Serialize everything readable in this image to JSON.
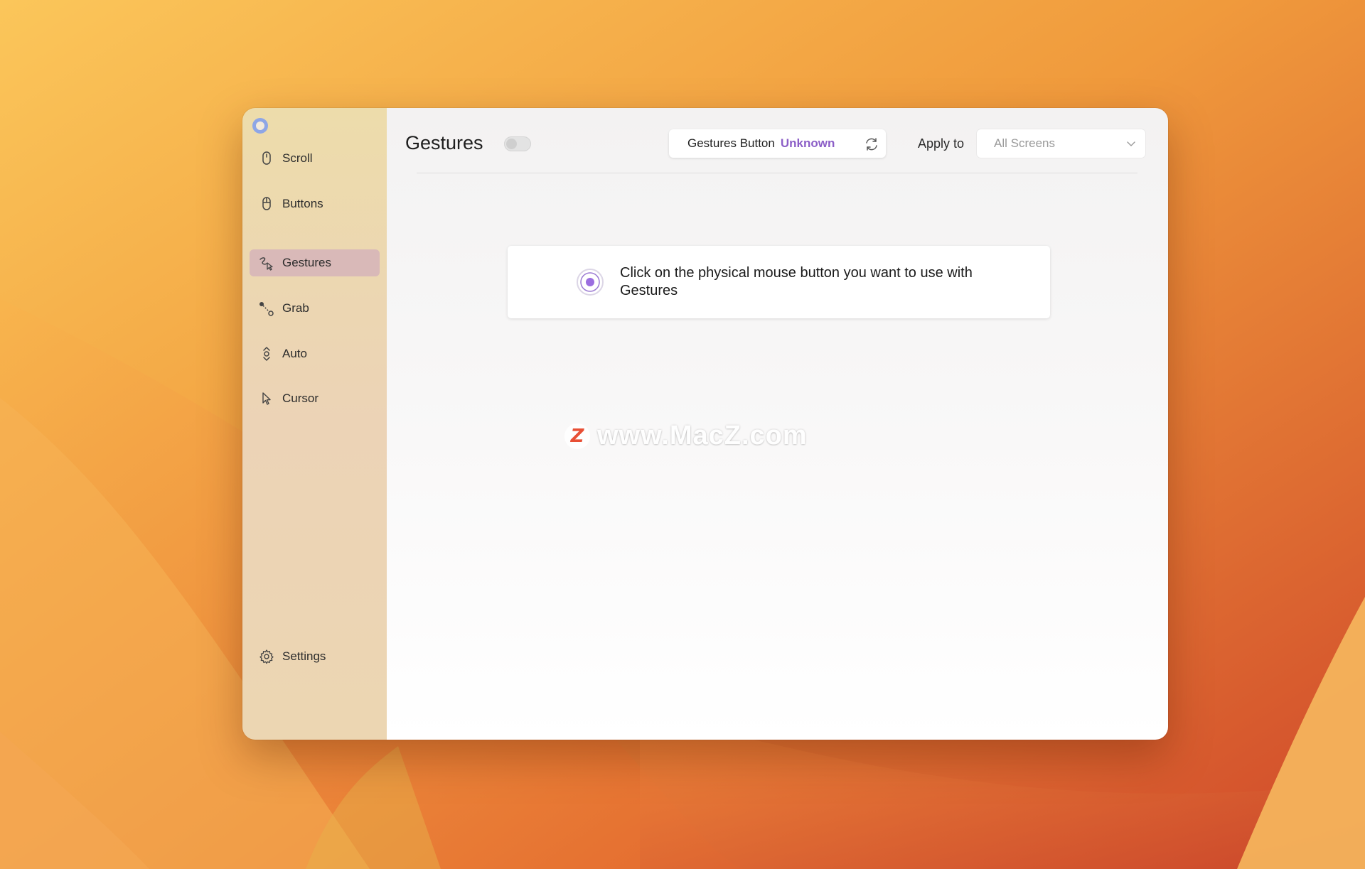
{
  "app": {
    "logo_icon": "circle-ring-icon",
    "accent_color": "#8c5fc7"
  },
  "sidebar": {
    "items": [
      {
        "id": "scroll",
        "label": "Scroll",
        "icon": "mouse-icon",
        "active": false
      },
      {
        "id": "buttons",
        "label": "Buttons",
        "icon": "mouse-buttons-icon",
        "active": false
      },
      {
        "id": "gestures",
        "label": "Gestures",
        "icon": "gesture-cursor-icon",
        "active": true
      },
      {
        "id": "grab",
        "label": "Grab",
        "icon": "grab-path-icon",
        "active": false
      },
      {
        "id": "auto",
        "label": "Auto",
        "icon": "auto-scroll-icon",
        "active": false
      },
      {
        "id": "cursor",
        "label": "Cursor",
        "icon": "cursor-arrow-icon",
        "active": false
      }
    ],
    "settings": {
      "label": "Settings",
      "icon": "gear-icon"
    }
  },
  "header": {
    "title": "Gestures",
    "toggle_enabled": false,
    "gestures_button_label": "Gestures Button",
    "gestures_button_value": "Unknown",
    "refresh_icon": "refresh-icon",
    "apply_to_label": "Apply to",
    "apply_to_value": "All Screens"
  },
  "prompt": {
    "text": "Click on the physical mouse button you want to use with Gestures",
    "icon": "record-radio-icon"
  },
  "watermark": {
    "badge": "Z",
    "text": "www.MacZ.com"
  }
}
